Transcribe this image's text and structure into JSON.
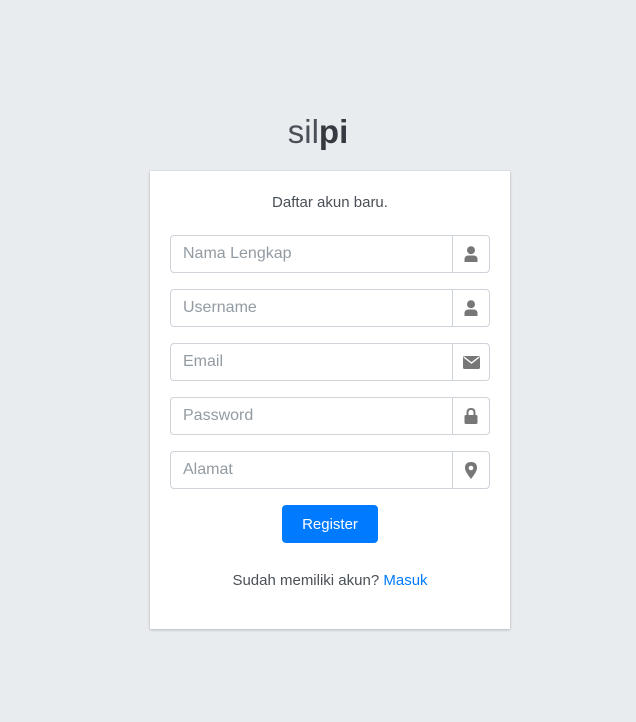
{
  "brand": {
    "light": "sil",
    "bold": "pi"
  },
  "form": {
    "subtitle": "Daftar akun baru.",
    "fields": [
      {
        "placeholder": "Nama Lengkap",
        "value": "",
        "icon": "user-icon"
      },
      {
        "placeholder": "Username",
        "value": "",
        "icon": "user-icon"
      },
      {
        "placeholder": "Email",
        "value": "",
        "icon": "envelope-icon"
      },
      {
        "placeholder": "Password",
        "value": "",
        "icon": "lock-icon"
      },
      {
        "placeholder": "Alamat",
        "value": "",
        "icon": "map-marker-icon"
      }
    ],
    "submit_label": "Register",
    "footer_text": "Sudah memiliki akun?",
    "footer_link": "Masuk"
  },
  "colors": {
    "background": "#e9ecef",
    "accent": "#007bff",
    "icon": "#777777"
  }
}
